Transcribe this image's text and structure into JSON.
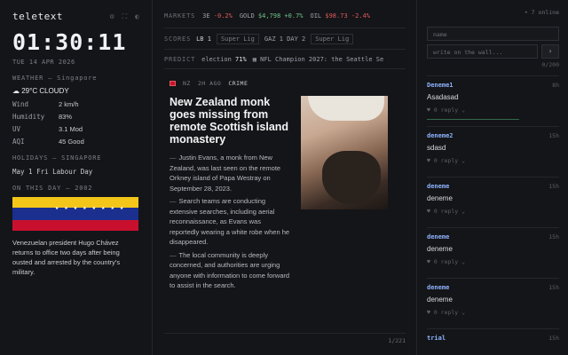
{
  "app": {
    "title": "teletext",
    "clock": "01:30:11",
    "date": "TUE 14 APR 2026"
  },
  "weather": {
    "header": "WEATHER — Singapore",
    "now": "29°C CLOUDY",
    "rows": [
      {
        "k": "Wind",
        "v": "2 km/h"
      },
      {
        "k": "Humidity",
        "v": "83%"
      },
      {
        "k": "UV",
        "v": "3.1 Mod"
      },
      {
        "k": "AQI",
        "v": "45 Good"
      }
    ]
  },
  "holidays": {
    "header": "HOLIDAYS — SINGAPORE",
    "item": "May 1 Fri  Labour Day"
  },
  "on_this_day": {
    "header": "ON THIS DAY — 2002",
    "stars": "★ ★ ★ ★ ★ ★ ★ ★",
    "text": "Venezuelan president Hugo Chávez returns to office two days after being ousted and arrested by the country's military."
  },
  "ticker": {
    "label": "MARKETS",
    "items": [
      {
        "name": "3E",
        "value": "-0.2%",
        "dir": "down"
      },
      {
        "name": "GOLD",
        "value": "$4,798 +0.7%",
        "dir": "up"
      },
      {
        "name": "OIL",
        "value": "$98.73 -2.4%",
        "dir": "down"
      }
    ]
  },
  "scores": {
    "label": "SCORES",
    "live": "LB 1",
    "pills": [
      "Super Lig",
      "Super Lig"
    ],
    "match": "GAZ 1  DAY 2"
  },
  "predict": {
    "label": "PREDICT",
    "item1": "election",
    "item1_pct": "71%",
    "item2": "NFL Champion 2027: the Seattle Se"
  },
  "article": {
    "meta_time": "2H AGO",
    "meta_prefix": "NZ",
    "meta_cat": "CRIME",
    "headline": "New Zealand monk goes missing from remote Scottish island monastery",
    "paragraphs": [
      "Justin Evans, a monk from New Zealand, was last seen on the remote Orkney island of Papa Westray on September 28, 2023.",
      "Search teams are conducting extensive searches, including aerial reconnaissance, as Evans was reportedly wearing a white robe when he disappeared.",
      "The local community is deeply concerned, and authorities are urging anyone with information to come forward to assist in the search."
    ],
    "pager": "1/221"
  },
  "chat": {
    "online": "• 7 online",
    "name_placeholder": "name",
    "wall_placeholder": "write on the wall...",
    "send": "›",
    "count": "0/200",
    "messages": [
      {
        "user": "Deneme1",
        "time": "8h",
        "text": "Asadasad",
        "actions": "♥ 0  reply  ⌄"
      },
      {
        "user": "deneme2",
        "time": "15h",
        "text": "sdasd",
        "actions": "♥ 0  reply  ⌄"
      },
      {
        "user": "deneme",
        "time": "15h",
        "text": "deneme",
        "actions": "♥ 0  reply  ⌄"
      },
      {
        "user": "deneme",
        "time": "15h",
        "text": "deneme",
        "actions": "♥ 0  reply  ⌄"
      },
      {
        "user": "deneme",
        "time": "15h",
        "text": "deneme",
        "actions": "♥ 0  reply  ⌄"
      },
      {
        "user": "trial",
        "time": "15h",
        "text": "",
        "actions": ""
      }
    ]
  }
}
